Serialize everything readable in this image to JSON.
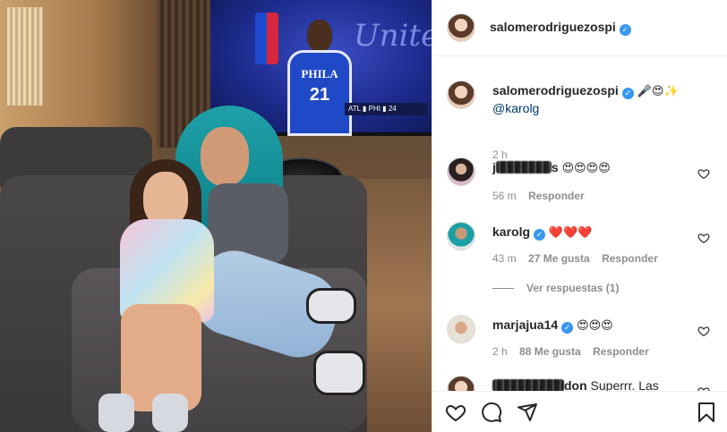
{
  "post": {
    "author": "salomerodriguezospi",
    "caption_emojis": "🎤😍✨",
    "caption_mention": "@karolg",
    "caption_time": "2 h",
    "tv": {
      "jersey_team": "PHILA",
      "jersey_number": "21"
    }
  },
  "comments": [
    {
      "name_visible_suffix": "s",
      "text": "😍😍😍😍",
      "time": "56 m",
      "reply_label": "Responder",
      "likes": "",
      "blurred": true
    },
    {
      "name": "karolg",
      "verified": true,
      "text": "❤️❤️❤️",
      "time": "43 m",
      "likes": "27 Me gusta",
      "reply_label": "Responder",
      "view_replies": "Ver respuestas (1)"
    },
    {
      "name": "marjajua14",
      "verified": true,
      "text": "😍😍😍",
      "time": "2 h",
      "likes": "88 Me gusta",
      "reply_label": "Responder"
    },
    {
      "name_visible_suffix": "don",
      "text": "Superrr. Las",
      "blurred": true
    }
  ],
  "icons": {
    "like": "heart-icon",
    "comment": "comment-icon",
    "share": "share-icon",
    "save": "bookmark-icon",
    "verified": "verified-badge-icon"
  },
  "colors": {
    "verified": "#3897f0",
    "mention": "#00376b",
    "meta": "#8e8e8e"
  }
}
